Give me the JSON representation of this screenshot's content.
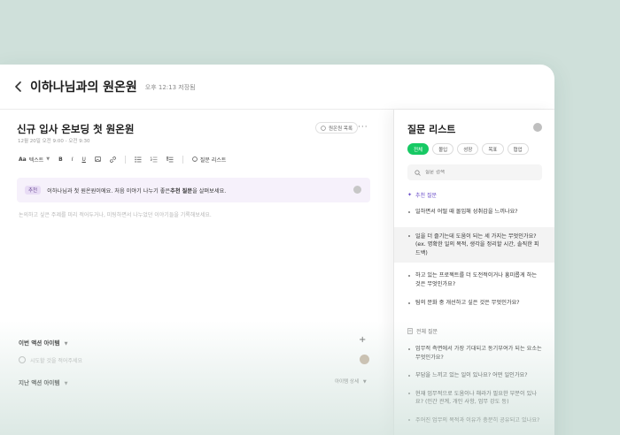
{
  "header": {
    "title": "이하나님과의 원온원",
    "saved_status": "오후 12:13 저장됨"
  },
  "document": {
    "title": "신규 입사 온보딩 첫 원온원",
    "date": "12월 20일 오전 9:00 - 오전 9:30",
    "list_button": "원온원 목록",
    "more_icon": "···"
  },
  "toolbar": {
    "text_style": "텍스트",
    "bold": "B",
    "italic": "I",
    "underline": "U",
    "question_list": "질문 리스트"
  },
  "banner": {
    "tag": "추천",
    "text_prefix": "이하나님과 첫 원온원이에요. 처음 이야기 나누기 좋은 ",
    "text_bold": "추천 질문",
    "text_suffix": "을 살펴보세요."
  },
  "editor": {
    "placeholder": "논의하고 싶은 주제를 미리 적어두거나, 미팅하면서 나누었던 이야기들을 기록해보세요."
  },
  "action_items": {
    "title": "이번 액션 아이템",
    "todo_placeholder": "시도할 것을 적어주세요",
    "add_icon": "+"
  },
  "prev_action_items": {
    "title": "지난 액션 아이템",
    "more": "아이템 상세"
  },
  "panel": {
    "title": "질문 리스트",
    "chips": [
      "전체",
      "몰입",
      "성장",
      "목표",
      "협업"
    ],
    "search_placeholder": "질문 검색",
    "recommended_label": "추천 질문",
    "recommended": [
      "일하면서 어떨 때 몰입해 성취감을 느끼나요?",
      "일을 더 즐기는데 도움이 되는 세 가지는 무엇인가요? (ex. 명확한 일의 목적, 생각을 정리할 시간, 솔직한 피드백)",
      "하고 있는 프로젝트를 더 도전적이거나 흥미롭게 하는 것은 무엇인가요?",
      "팀의 문화 중 개선하고 싶은 것은 무엇인가요?"
    ],
    "all_label": "전체 질문",
    "all": [
      "업무적 측면에서 가장 기대되고 동기부여가 되는 요소는 무엇인가요?",
      "부담을 느끼고 있는 일이 있나요? 어떤 일인가요?",
      "현재 업무적으로 도움이나 해라가 필요한 부분이 있나요? (인간 관계, 개인 사항, 업무 강도 등)",
      "주어진 업무의 목적과 이유가 충분히 공유되고 있나요?"
    ]
  },
  "colors": {
    "accent": "#17c964",
    "background": "#cfe0da",
    "banner": "#f6f1fb"
  }
}
